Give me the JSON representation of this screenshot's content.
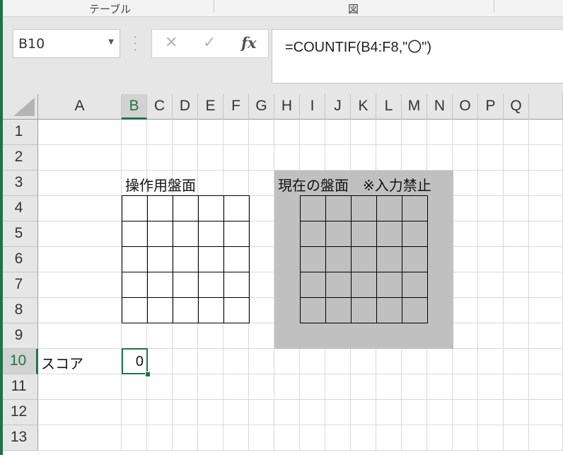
{
  "ribbon": {
    "groups": [
      "テーブル",
      "図"
    ]
  },
  "name_box": {
    "value": "B10"
  },
  "formula_bar": {
    "cancel_glyph": "✕",
    "enter_glyph": "✓",
    "fx_label": "fx",
    "formula": "=COUNTIF(B4:F8,\"〇\")"
  },
  "columns": [
    "A",
    "B",
    "C",
    "D",
    "E",
    "F",
    "G",
    "H",
    "I",
    "J",
    "K",
    "L",
    "M",
    "N",
    "O",
    "P",
    "Q"
  ],
  "rows": [
    "1",
    "2",
    "3",
    "4",
    "5",
    "6",
    "7",
    "8",
    "9",
    "10",
    "11",
    "12",
    "13"
  ],
  "selected": {
    "column": "B",
    "row": "10"
  },
  "cells": {
    "B3": "操作用盤面",
    "H3": "現在の盤面　※入力禁止",
    "A10": "スコア",
    "B10": "0"
  },
  "colors": {
    "accent": "#217346",
    "locked_area": "#c0c0c0"
  }
}
